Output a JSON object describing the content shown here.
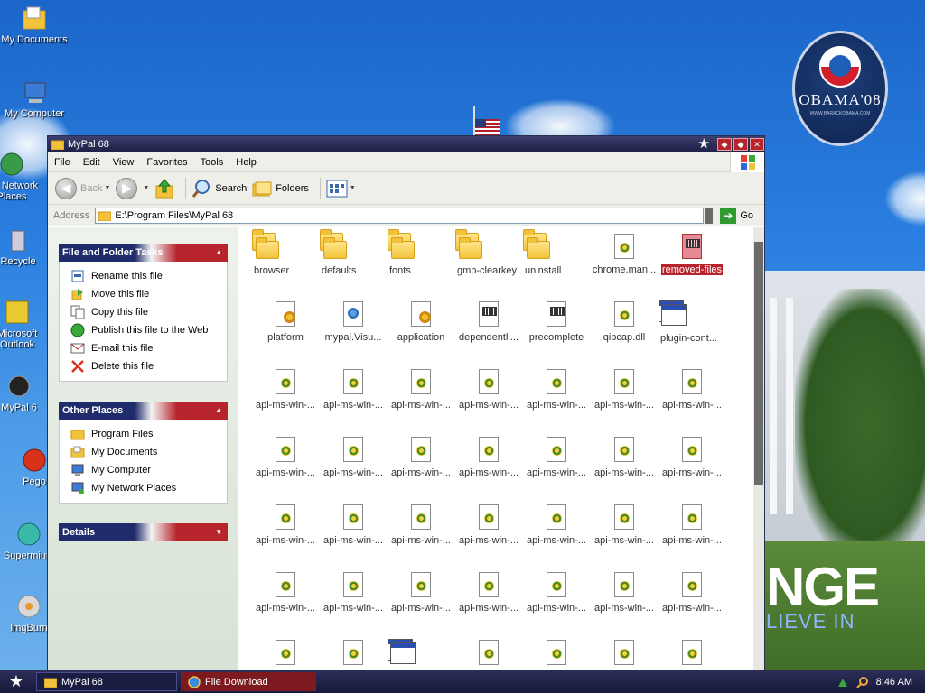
{
  "desktop": {
    "icons": [
      {
        "label": "My Documents"
      },
      {
        "label": "My Computer"
      },
      {
        "label": "My Network Places"
      },
      {
        "label": "Recycle"
      },
      {
        "label": "Microsoft Outlook"
      },
      {
        "label": "MyPal 6"
      },
      {
        "label": "Pego"
      },
      {
        "label": "Supermium"
      },
      {
        "label": "ImgBurn"
      }
    ],
    "badge_title": "OBAMA'08",
    "badge_url": "WWW.BARACKOBAMA.COM",
    "banner_big": "NGE",
    "banner_small": "LIEVE IN"
  },
  "window": {
    "title": "MyPal 68",
    "menu": [
      "File",
      "Edit",
      "View",
      "Favorites",
      "Tools",
      "Help"
    ],
    "toolbar": {
      "back": "Back",
      "search": "Search",
      "folders": "Folders"
    },
    "address": {
      "label": "Address",
      "value": "E:\\Program Files\\MyPal 68",
      "go": "Go"
    }
  },
  "tasks": {
    "file_folder": {
      "title": "File and Folder Tasks",
      "items": [
        "Rename this file",
        "Move this file",
        "Copy this file",
        "Publish this file to the Web",
        "E-mail this file",
        "Delete this file"
      ]
    },
    "other_places": {
      "title": "Other Places",
      "items": [
        "Program Files",
        "My Documents",
        "My Computer",
        "My Network Places"
      ]
    },
    "details": {
      "title": "Details"
    }
  },
  "files": [
    {
      "name": "browser",
      "type": "folder"
    },
    {
      "name": "defaults",
      "type": "folder"
    },
    {
      "name": "fonts",
      "type": "folder"
    },
    {
      "name": "gmp-clearkey",
      "type": "folder"
    },
    {
      "name": "uninstall",
      "type": "folder"
    },
    {
      "name": "chrome.man...",
      "type": "dll"
    },
    {
      "name": "removed-files",
      "type": "red",
      "selected": true
    },
    {
      "name": "platform",
      "type": "cfg"
    },
    {
      "name": "mypal.Visu...",
      "type": "manif"
    },
    {
      "name": "application",
      "type": "cfg"
    },
    {
      "name": "dependentli...",
      "type": "txtd"
    },
    {
      "name": "precomplete",
      "type": "txtd"
    },
    {
      "name": "qipcap.dll",
      "type": "dll"
    },
    {
      "name": "plugin-cont...",
      "type": "wnd"
    },
    {
      "name": "api-ms-win-...",
      "type": "dll"
    },
    {
      "name": "api-ms-win-...",
      "type": "dll"
    },
    {
      "name": "api-ms-win-...",
      "type": "dll"
    },
    {
      "name": "api-ms-win-...",
      "type": "dll"
    },
    {
      "name": "api-ms-win-...",
      "type": "dll"
    },
    {
      "name": "api-ms-win-...",
      "type": "dll"
    },
    {
      "name": "api-ms-win-...",
      "type": "dll"
    },
    {
      "name": "api-ms-win-...",
      "type": "dll"
    },
    {
      "name": "api-ms-win-...",
      "type": "dll"
    },
    {
      "name": "api-ms-win-...",
      "type": "dll"
    },
    {
      "name": "api-ms-win-...",
      "type": "dll"
    },
    {
      "name": "api-ms-win-...",
      "type": "dll"
    },
    {
      "name": "api-ms-win-...",
      "type": "dll"
    },
    {
      "name": "api-ms-win-...",
      "type": "dll"
    },
    {
      "name": "api-ms-win-...",
      "type": "dll"
    },
    {
      "name": "api-ms-win-...",
      "type": "dll"
    },
    {
      "name": "api-ms-win-...",
      "type": "dll"
    },
    {
      "name": "api-ms-win-...",
      "type": "dll"
    },
    {
      "name": "api-ms-win-...",
      "type": "dll"
    },
    {
      "name": "api-ms-win-...",
      "type": "dll"
    },
    {
      "name": "api-ms-win-...",
      "type": "dll"
    },
    {
      "name": "api-ms-win-...",
      "type": "dll"
    },
    {
      "name": "api-ms-win-...",
      "type": "dll"
    },
    {
      "name": "api-ms-win-...",
      "type": "dll"
    },
    {
      "name": "api-ms-win-...",
      "type": "dll"
    },
    {
      "name": "api-ms-win-...",
      "type": "dll"
    },
    {
      "name": "api-ms-win-...",
      "type": "dll"
    },
    {
      "name": "api-ms-win-...",
      "type": "dll"
    },
    {
      "name": "",
      "type": "dll"
    },
    {
      "name": "",
      "type": "dll"
    },
    {
      "name": "",
      "type": "wnd"
    },
    {
      "name": "",
      "type": "dll"
    },
    {
      "name": "",
      "type": "dll"
    },
    {
      "name": "",
      "type": "dll"
    },
    {
      "name": "",
      "type": "dll"
    }
  ],
  "taskbar": {
    "items": [
      {
        "label": "MyPal 68",
        "active": true
      },
      {
        "label": "File Download",
        "active": false
      }
    ],
    "clock": "8:46 AM"
  },
  "colors": {
    "accent_red": "#b8242c",
    "accent_navy": "#1f2b6b",
    "title_dark": "#1d1f44"
  }
}
